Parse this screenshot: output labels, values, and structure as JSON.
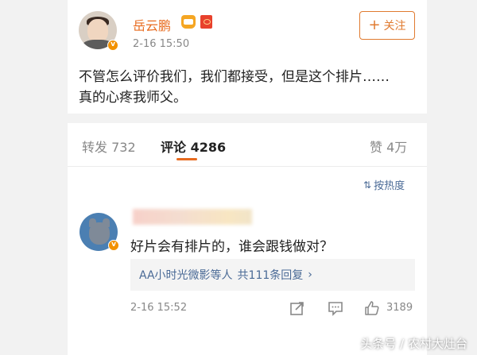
{
  "post": {
    "username": "岳云鹏",
    "time": "2-16 15:50",
    "follow_label": "关注",
    "text_line1": "不管怎么评价我们，我们都接受，但是这个排片……",
    "text_line2": "真的心疼我师父。"
  },
  "tabs": {
    "repost": "转发 732",
    "comment": "评论 4286",
    "like": "赞 4万"
  },
  "sort": {
    "label": "按热度"
  },
  "comment": {
    "text": "好片会有排片的，谁会跟钱做对？",
    "reply_names": "AA小时光微影等人",
    "reply_count": "共111条回复",
    "time": "2-16 15:52",
    "likes": "3189"
  },
  "watermark": "头条号 / 农村大灶台",
  "colors": {
    "accent": "#e86b1f",
    "link": "#4a6a96",
    "verified": "#f29100"
  },
  "icons": [
    "crown-icon",
    "red-envelope-icon",
    "share-icon",
    "comment-icon",
    "thumbs-up-icon",
    "sort-icon",
    "chevron-right-icon"
  ]
}
